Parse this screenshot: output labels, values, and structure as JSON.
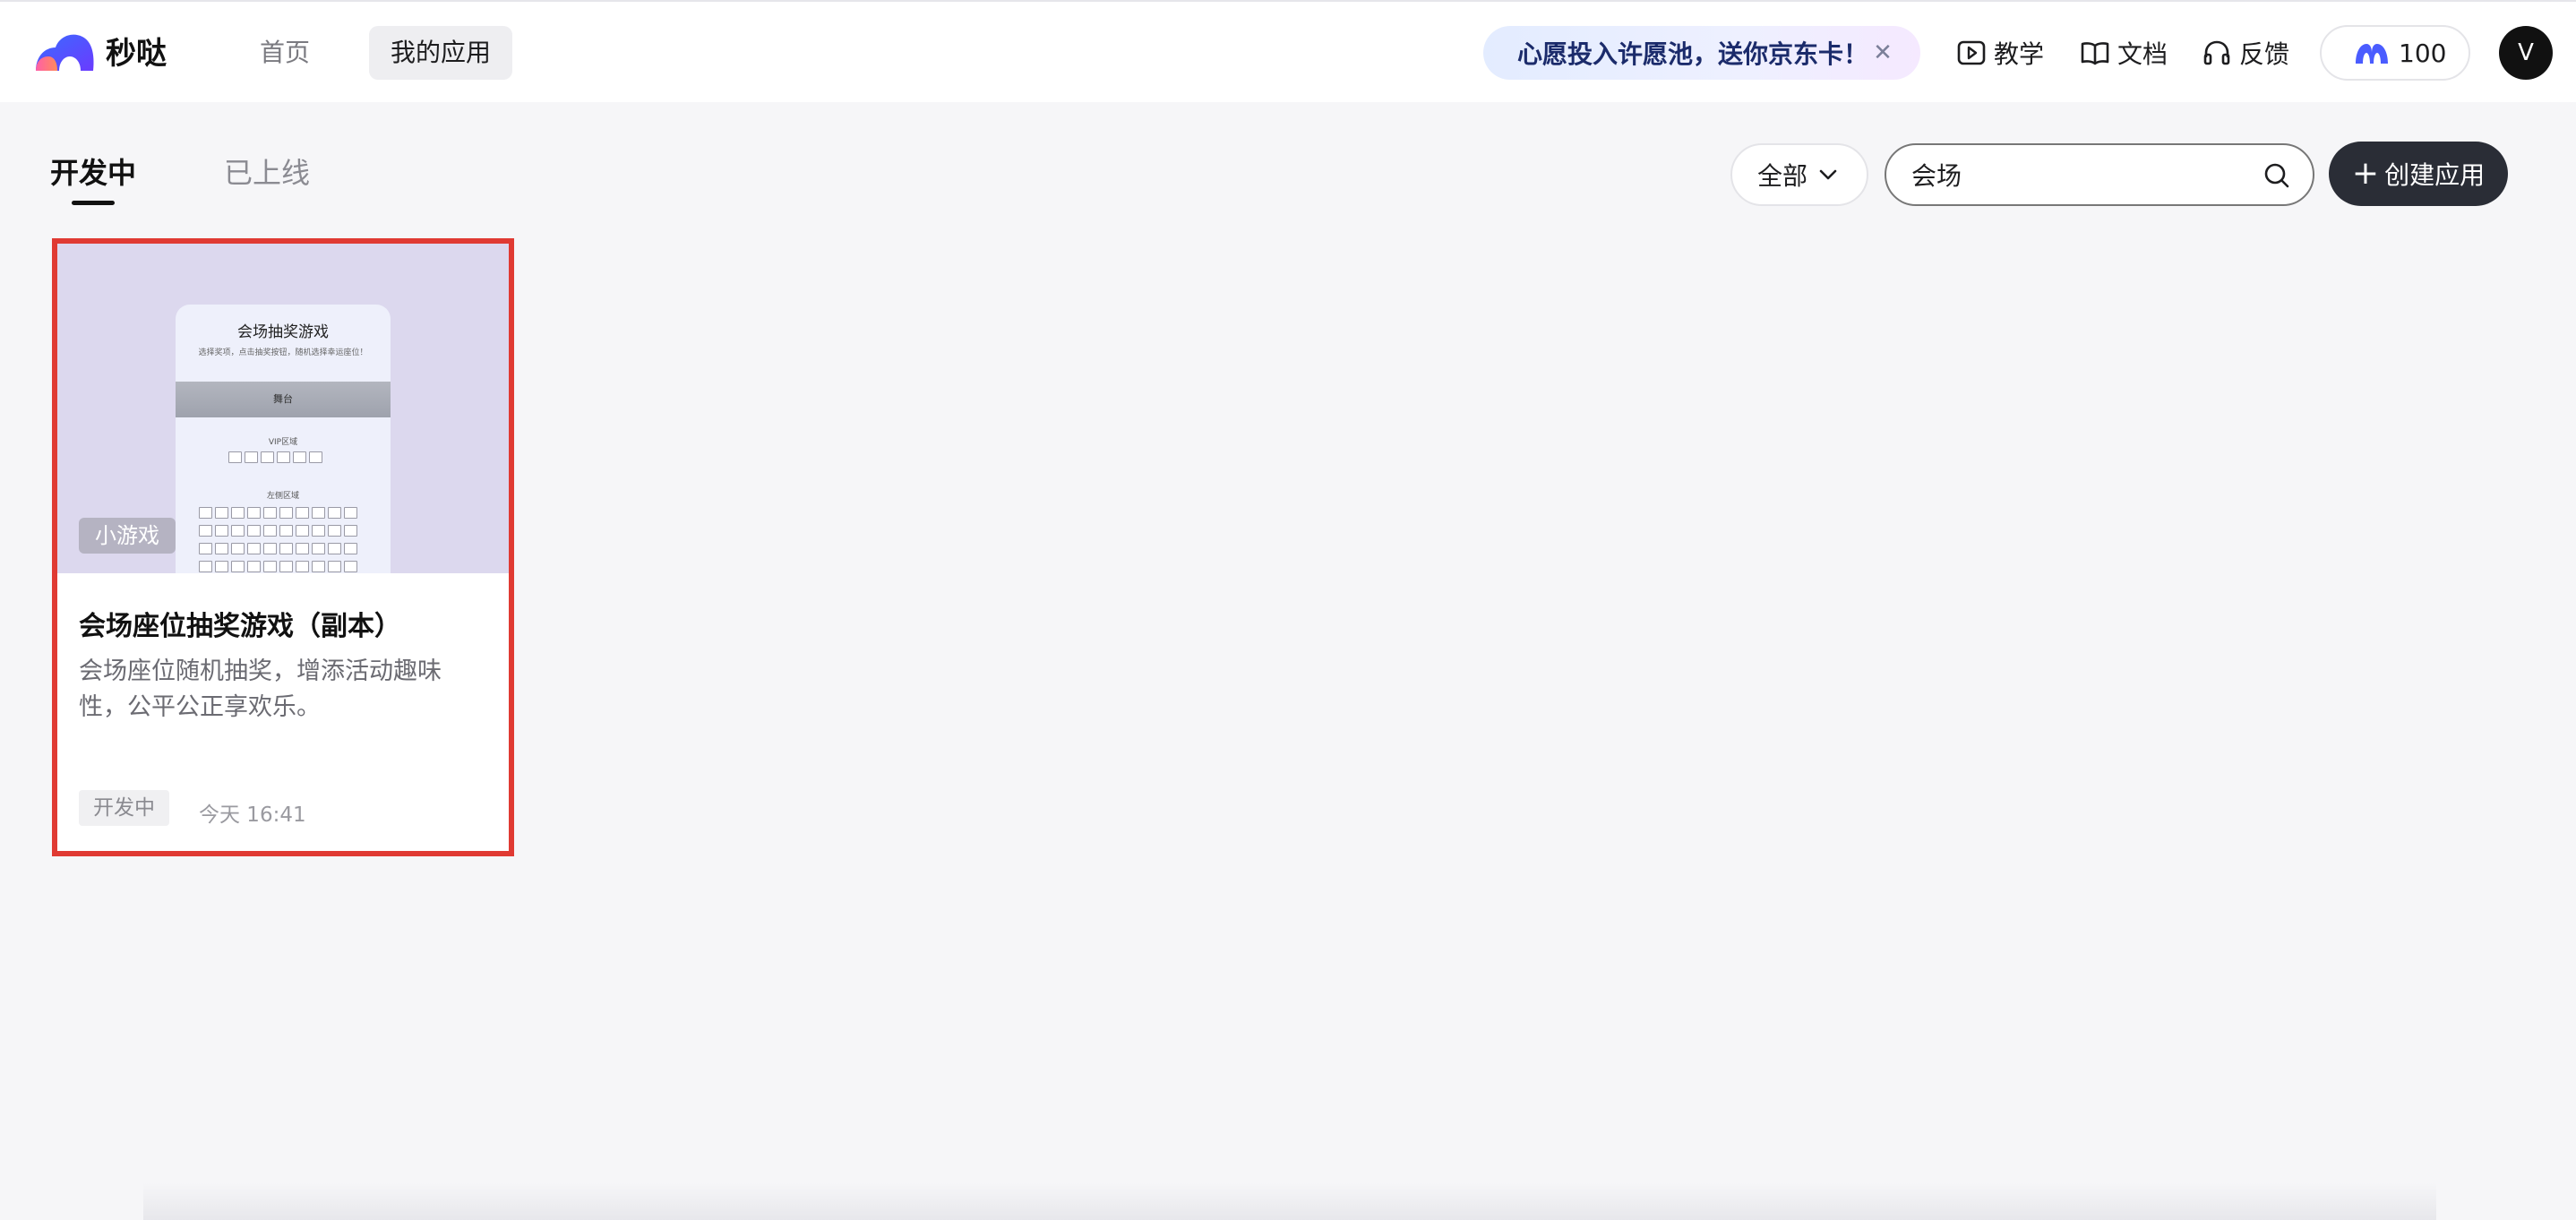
{
  "app": {
    "name": "秒哒",
    "accent": "#2a2d36",
    "highlight": "#e03a33"
  },
  "nav": {
    "home": "首页",
    "my_apps": "我的应用"
  },
  "promo": {
    "text": "心愿投入许愿池，送你京东卡！",
    "close_icon": "close-icon"
  },
  "header_links": {
    "tutorial": "教学",
    "docs": "文档",
    "feedback": "反馈"
  },
  "credits": {
    "value": "100"
  },
  "user": {
    "avatar_initial": "V"
  },
  "tabs": {
    "developing": "开发中",
    "online": "已上线"
  },
  "filter": {
    "selected": "全部"
  },
  "search": {
    "value": "会场"
  },
  "create_button": {
    "plus": "+",
    "label": "创建应用"
  },
  "apps": [
    {
      "category": "小游戏",
      "title": "会场座位抽奖游戏（副本）",
      "description": "会场座位随机抽奖，增添活动趣味性，公平公正享欢乐。",
      "status": "开发中",
      "updated": "今天 16:41",
      "preview": {
        "title": "会场抽奖游戏",
        "subtitle": "选择奖项，点击抽奖按钮，随机选择幸运座位！",
        "stage": "舞台",
        "zone_vip": "VIP区域",
        "zone_left": "左侧区域"
      }
    }
  ]
}
